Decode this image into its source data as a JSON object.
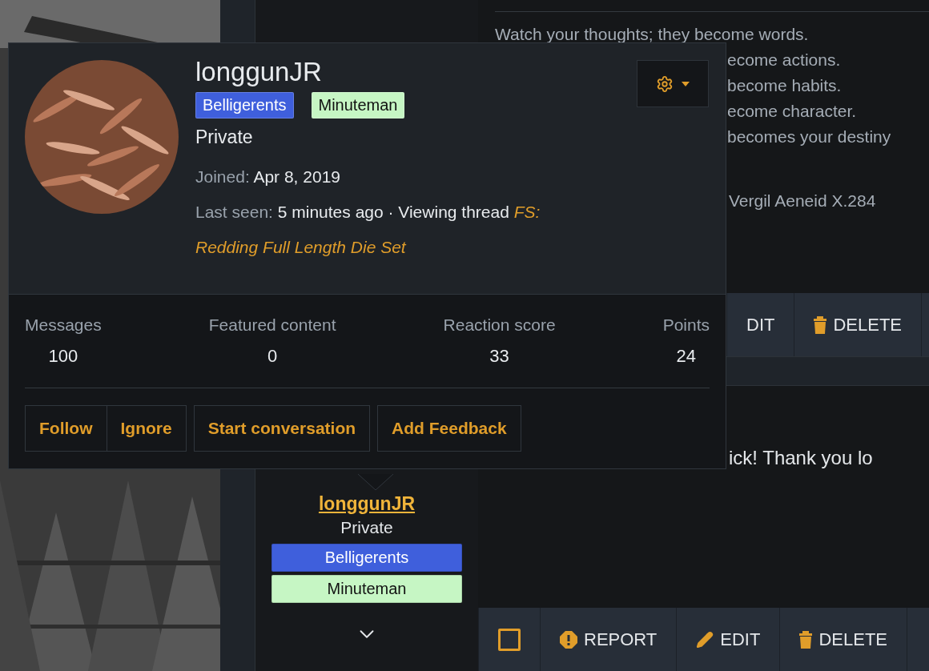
{
  "posts": [
    {
      "quote_first_line": "Watch your thoughts; they become words.",
      "quote_fragments": [
        "ecome actions.",
        "become habits.",
        "ecome character.",
        "becomes your destiny"
      ],
      "attribution": "Vergil Aeneid X.284",
      "actions": [
        {
          "kind": "edit",
          "label": "DIT",
          "show_icon": false
        },
        {
          "kind": "delete",
          "label": "DELETE"
        }
      ]
    },
    {
      "text": "ick! Thank you lo",
      "author": {
        "username": "longgunJR",
        "title": "Private",
        "badges": [
          {
            "label": "Belligerents",
            "color": "#3f5fdc"
          },
          {
            "label": "Minuteman",
            "color": "#c6f6c4"
          }
        ]
      },
      "actions": [
        {
          "kind": "select",
          "checked": false
        },
        {
          "kind": "report",
          "label": "REPORT"
        },
        {
          "kind": "edit",
          "label": "EDIT",
          "show_icon": true
        },
        {
          "kind": "delete",
          "label": "DELETE"
        }
      ]
    }
  ],
  "popup": {
    "username": "longgunJR",
    "badges": [
      {
        "label": "Belligerents",
        "color": "#3f5fdc"
      },
      {
        "label": "Minuteman",
        "color": "#c6f6c4"
      }
    ],
    "title": "Private",
    "joined_label": "Joined:",
    "joined": "Apr 8, 2019",
    "last_seen_label": "Last seen:",
    "activity": "5 minutes ago · Viewing thread",
    "thread_link_lines": [
      "FS:",
      "Redding Full Length Die Set"
    ],
    "stats": [
      {
        "label": "Messages",
        "value": "100"
      },
      {
        "label": "Featured content",
        "value": "0"
      },
      {
        "label": "Reaction score",
        "value": "33"
      },
      {
        "label": "Points",
        "value": "24"
      }
    ],
    "button_groups": [
      {
        "buttons": [
          "Follow",
          "Ignore"
        ]
      },
      {
        "buttons": [
          "Start conversation"
        ]
      },
      {
        "buttons": [
          "Add Feedback"
        ]
      }
    ]
  }
}
